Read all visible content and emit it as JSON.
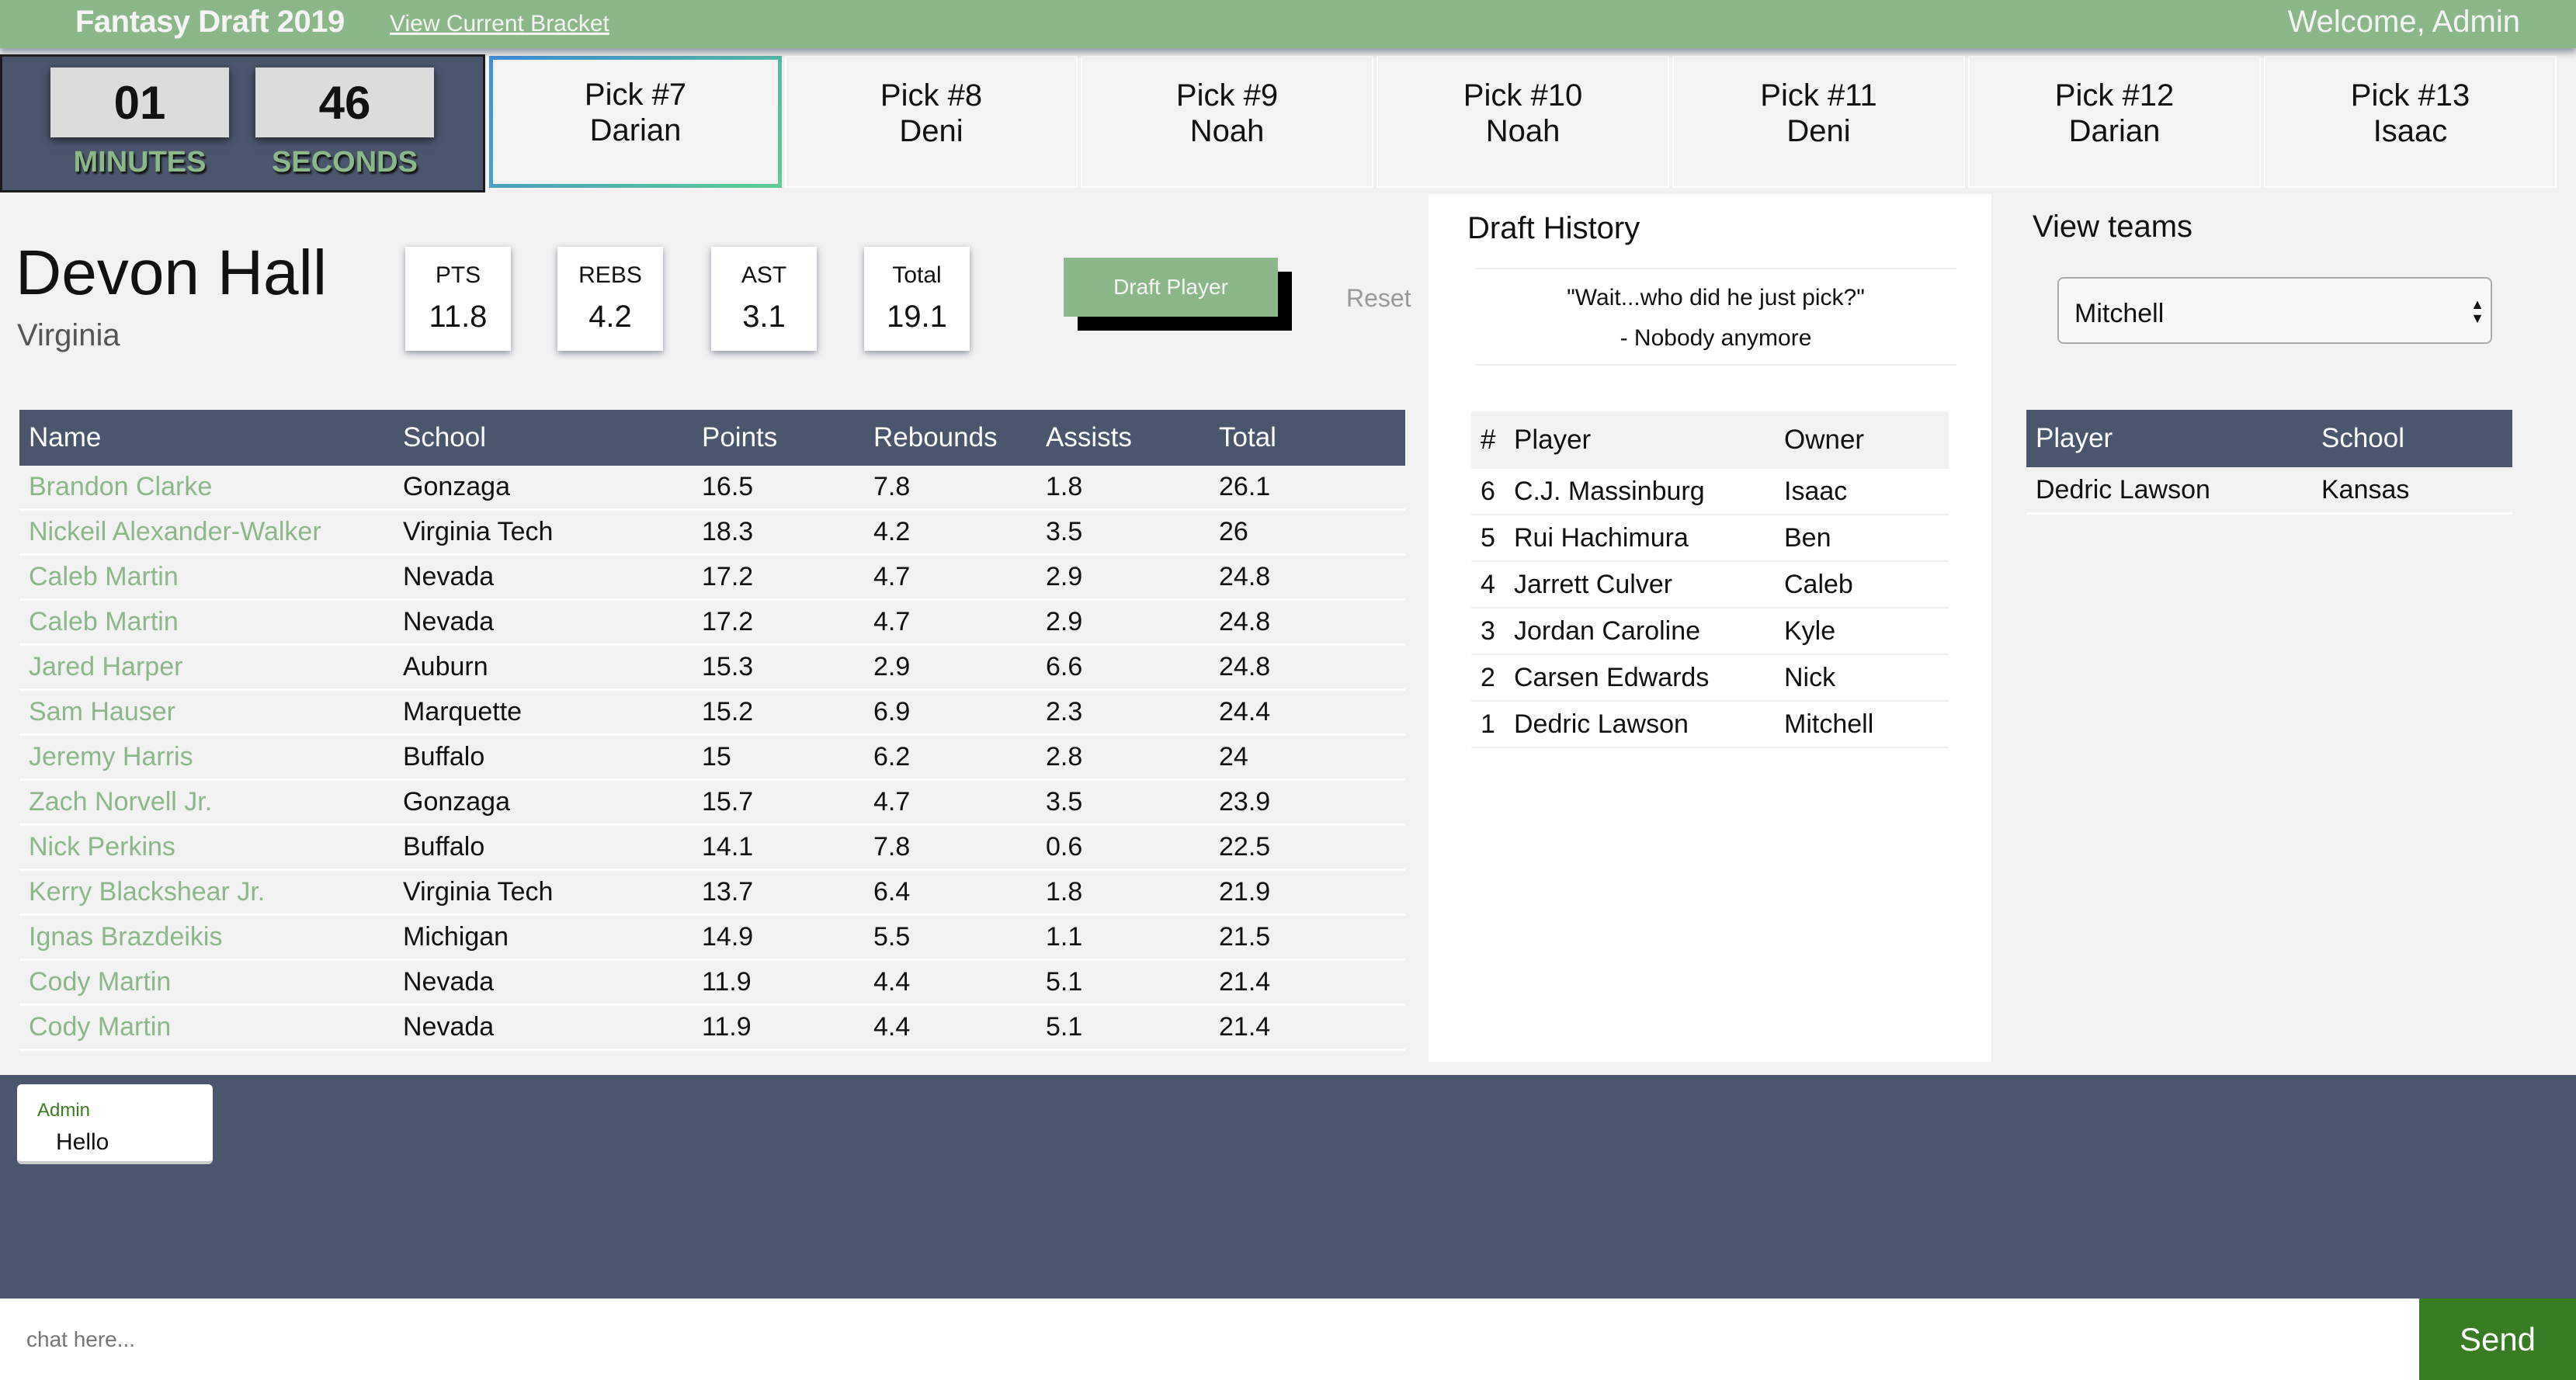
{
  "header": {
    "title": "Fantasy Draft 2019",
    "bracket_link": "View Current Bracket",
    "welcome": "Welcome, Admin"
  },
  "timer": {
    "minutes": "01",
    "seconds": "46",
    "minutes_label": "MINUTES",
    "seconds_label": "SECONDS"
  },
  "picks": [
    {
      "label": "Pick #7",
      "owner": "Darian",
      "active": true
    },
    {
      "label": "Pick #8",
      "owner": "Deni"
    },
    {
      "label": "Pick #9",
      "owner": "Noah"
    },
    {
      "label": "Pick #10",
      "owner": "Noah"
    },
    {
      "label": "Pick #11",
      "owner": "Deni"
    },
    {
      "label": "Pick #12",
      "owner": "Darian"
    },
    {
      "label": "Pick #13",
      "owner": "Isaac"
    }
  ],
  "selected_player": {
    "name": "Devon Hall",
    "school": "Virginia",
    "stats": [
      {
        "label": "PTS",
        "value": "11.8"
      },
      {
        "label": "REBS",
        "value": "4.2"
      },
      {
        "label": "AST",
        "value": "3.1"
      },
      {
        "label": "Total",
        "value": "19.1"
      }
    ],
    "draft_button": "Draft Player",
    "reset_button": "Reset"
  },
  "players_table": {
    "columns": [
      "Name",
      "School",
      "Points",
      "Rebounds",
      "Assists",
      "Total"
    ],
    "rows": [
      [
        "Brandon Clarke",
        "Gonzaga",
        "16.5",
        "7.8",
        "1.8",
        "26.1"
      ],
      [
        "Nickeil Alexander-Walker",
        "Virginia Tech",
        "18.3",
        "4.2",
        "3.5",
        "26"
      ],
      [
        "Caleb Martin",
        "Nevada",
        "17.2",
        "4.7",
        "2.9",
        "24.8"
      ],
      [
        "Caleb Martin",
        "Nevada",
        "17.2",
        "4.7",
        "2.9",
        "24.8"
      ],
      [
        "Jared Harper",
        "Auburn",
        "15.3",
        "2.9",
        "6.6",
        "24.8"
      ],
      [
        "Sam Hauser",
        "Marquette",
        "15.2",
        "6.9",
        "2.3",
        "24.4"
      ],
      [
        "Jeremy Harris",
        "Buffalo",
        "15",
        "6.2",
        "2.8",
        "24"
      ],
      [
        "Zach Norvell Jr.",
        "Gonzaga",
        "15.7",
        "4.7",
        "3.5",
        "23.9"
      ],
      [
        "Nick Perkins",
        "Buffalo",
        "14.1",
        "7.8",
        "0.6",
        "22.5"
      ],
      [
        "Kerry Blackshear Jr.",
        "Virginia Tech",
        "13.7",
        "6.4",
        "1.8",
        "21.9"
      ],
      [
        "Ignas Brazdeikis",
        "Michigan",
        "14.9",
        "5.5",
        "1.1",
        "21.5"
      ],
      [
        "Cody Martin",
        "Nevada",
        "11.9",
        "4.4",
        "5.1",
        "21.4"
      ],
      [
        "Cody Martin",
        "Nevada",
        "11.9",
        "4.4",
        "5.1",
        "21.4"
      ]
    ]
  },
  "draft_history": {
    "title": "Draft History",
    "quote": "\"Wait...who did he just pick?\"",
    "quote_author": "- Nobody anymore",
    "columns": [
      "#",
      "Player",
      "Owner"
    ],
    "rows": [
      [
        "6",
        "C.J. Massinburg",
        "Isaac"
      ],
      [
        "5",
        "Rui Hachimura",
        "Ben"
      ],
      [
        "4",
        "Jarrett Culver",
        "Caleb"
      ],
      [
        "3",
        "Jordan Caroline",
        "Kyle"
      ],
      [
        "2",
        "Carsen Edwards",
        "Nick"
      ],
      [
        "1",
        "Dedric Lawson",
        "Mitchell"
      ]
    ]
  },
  "view_teams": {
    "title": "View teams",
    "selected_team": "Mitchell",
    "columns": [
      "Player",
      "School"
    ],
    "rows": [
      [
        "Dedric Lawson",
        "Kansas"
      ]
    ]
  },
  "chat": {
    "messages": [
      {
        "author": "Admin",
        "text": "Hello"
      }
    ],
    "input_placeholder": "chat here...",
    "send_label": "Send"
  },
  "colors": {
    "brand_green": "#8bb888",
    "navy": "#4a566d",
    "send_green": "#387d23"
  }
}
